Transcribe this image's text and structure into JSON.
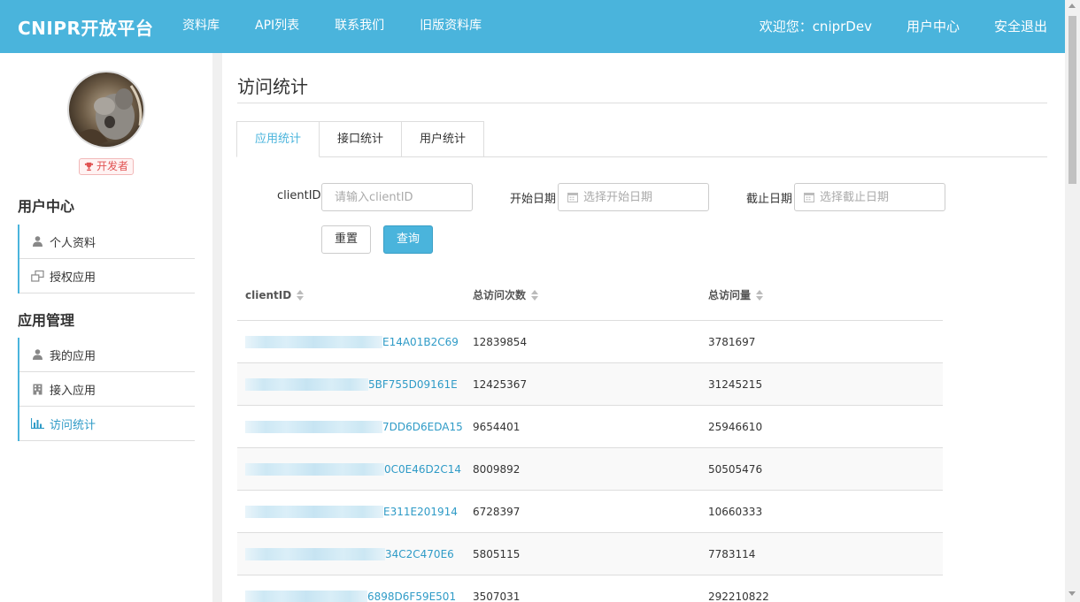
{
  "header": {
    "brand": "CNIPR开放平台",
    "nav": [
      "资料库",
      "API列表",
      "联系我们",
      "旧版资料库"
    ],
    "welcome": "欢迎您：cniprDev",
    "user_center": "用户中心",
    "logout": "安全退出"
  },
  "sidebar": {
    "badge": "开发者",
    "section1_title": "用户中心",
    "section1_items": [
      {
        "label": "个人资料",
        "icon": "user-icon"
      },
      {
        "label": "授权应用",
        "icon": "window-icon"
      }
    ],
    "section2_title": "应用管理",
    "section2_items": [
      {
        "label": "我的应用",
        "icon": "user-icon"
      },
      {
        "label": "接入应用",
        "icon": "building-icon"
      },
      {
        "label": "访问统计",
        "icon": "bar-chart-icon",
        "active": true
      }
    ]
  },
  "main": {
    "title": "访问统计",
    "tabs": [
      "应用统计",
      "接口统计",
      "用户统计"
    ],
    "active_tab": 0,
    "filters": {
      "client_label": "clientID",
      "client_placeholder": "请输入clientID",
      "start_label": "开始日期",
      "start_placeholder": "选择开始日期",
      "end_label": "截止日期",
      "end_placeholder": "选择截止日期",
      "reset": "重置",
      "query": "查询"
    },
    "table": {
      "columns": [
        "clientID",
        "总访问次数",
        "总访问量"
      ],
      "rows": [
        {
          "client_suffix": "E14A01B2C69",
          "visits": "12839854",
          "volume": "3781697"
        },
        {
          "client_suffix": "5BF755D09161E",
          "visits": "12425367",
          "volume": "31245215"
        },
        {
          "client_suffix": "7DD6D6EDA15",
          "visits": "9654401",
          "volume": "25946610"
        },
        {
          "client_suffix": "0C0E46D2C14",
          "visits": "8009892",
          "volume": "50505476"
        },
        {
          "client_suffix": "E311E201914",
          "visits": "6728397",
          "volume": "10660333"
        },
        {
          "client_suffix": "34C2C470E6",
          "visits": "5805115",
          "volume": "7783114"
        },
        {
          "client_suffix": "6898D6F59E501",
          "visits": "3507031",
          "volume": "292210822"
        }
      ]
    }
  },
  "colors": {
    "accent": "#4ab4dc",
    "link": "#2f9bc7",
    "badge_text": "#e05252"
  }
}
